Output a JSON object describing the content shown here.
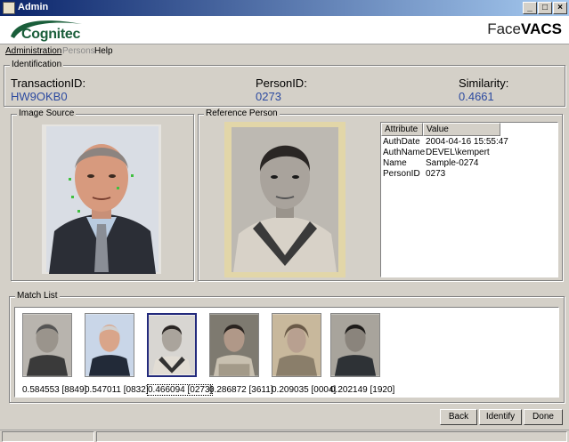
{
  "window": {
    "title": "Admin"
  },
  "header": {
    "brand_left": "Cognitec",
    "brand_right_a": "Face",
    "brand_right_b": "VACS"
  },
  "menu": [
    {
      "label": "Administration",
      "enabled": true
    },
    {
      "label": "Persons",
      "enabled": false
    },
    {
      "label": "Help",
      "enabled": true
    }
  ],
  "identification": {
    "legend": "Identification",
    "transaction_label": "TransactionID:",
    "transaction_value": "HW9OKB0",
    "person_label": "PersonID:",
    "person_value": "0273",
    "similarity_label": "Similarity:",
    "similarity_value": "0.4661"
  },
  "image_source": {
    "legend": "Image Source",
    "icon": "probe-face-photo"
  },
  "reference_person": {
    "legend": "Reference Person",
    "icon": "reference-face-photo",
    "columns": [
      "Attribute",
      "Value"
    ],
    "rows": [
      {
        "attribute": "AuthDate",
        "value": "2004-04-16 15:55:47"
      },
      {
        "attribute": "AuthName",
        "value": "DEVEL\\kempert"
      },
      {
        "attribute": "Name",
        "value": "Sample-0274"
      },
      {
        "attribute": "PersonID",
        "value": "0273"
      }
    ]
  },
  "match_list": {
    "legend": "Match List",
    "items": [
      {
        "caption": "0.584553 [8849]",
        "selected": false
      },
      {
        "caption": "0.547011 [0832]",
        "selected": false
      },
      {
        "caption": "0.466094 [0273]",
        "selected": true
      },
      {
        "caption": "0.286872 [3611]",
        "selected": false
      },
      {
        "caption": "0.209035 [0004]",
        "selected": false
      },
      {
        "caption": "0.202149 [1920]",
        "selected": false
      }
    ]
  },
  "buttons": {
    "back": "Back",
    "identify": "Identify",
    "done": "Done"
  },
  "colors": {
    "value_text": "#2c4aa0",
    "selected_border": "#232a7c",
    "title_bar": "#0a246a"
  }
}
